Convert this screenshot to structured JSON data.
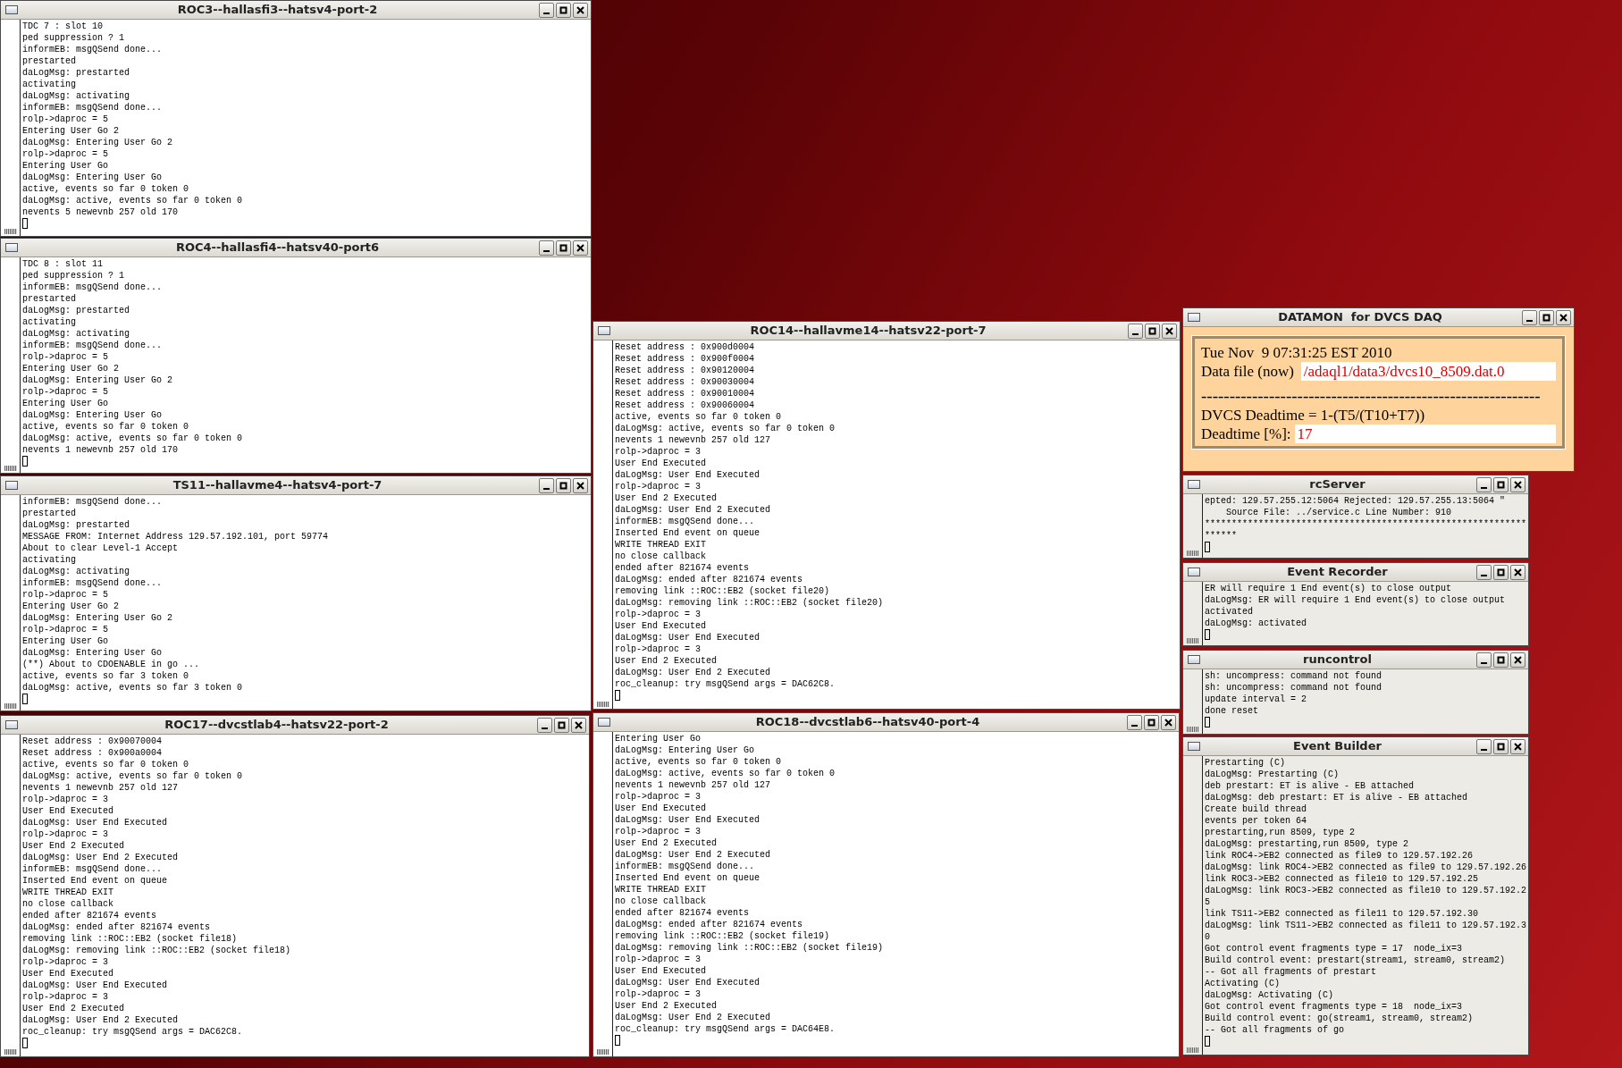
{
  "windows": [
    {
      "kind": "terminal",
      "title": "ROC3--hallasfi3--hatsv4-port-2",
      "lines": [
        "TDC 7 : slot 10",
        "ped suppression ? 1",
        "informEB: msgQSend done...",
        "prestarted",
        "daLogMsg: prestarted",
        "activating",
        "daLogMsg: activating",
        "informEB: msgQSend done...",
        "rolp->daproc = 5",
        "Entering User Go 2",
        "daLogMsg: Entering User Go 2",
        "rolp->daproc = 5",
        "Entering User Go",
        "daLogMsg: Entering User Go",
        "active, events so far 0 token 0",
        "daLogMsg: active, events so far 0 token 0",
        "nevents 5 newevnb 257 old 170"
      ]
    },
    {
      "kind": "terminal",
      "title": "ROC4--hallasfi4--hatsv40-port6",
      "lines": [
        "TDC 8 : slot 11",
        "ped suppression ? 1",
        "informEB: msgQSend done...",
        "prestarted",
        "daLogMsg: prestarted",
        "activating",
        "daLogMsg: activating",
        "informEB: msgQSend done...",
        "rolp->daproc = 5",
        "Entering User Go 2",
        "daLogMsg: Entering User Go 2",
        "rolp->daproc = 5",
        "Entering User Go",
        "daLogMsg: Entering User Go",
        "active, events so far 0 token 0",
        "daLogMsg: active, events so far 0 token 0",
        "nevents 1 newevnb 257 old 170"
      ]
    },
    {
      "kind": "terminal",
      "title": "TS11--hallavme4--hatsv4-port-7",
      "lines": [
        "informEB: msgQSend done...",
        "prestarted",
        "daLogMsg: prestarted",
        "MESSAGE FROM: Internet Address 129.57.192.101, port 59774",
        "About to clear Level-1 Accept",
        "activating",
        "daLogMsg: activating",
        "informEB: msgQSend done...",
        "rolp->daproc = 5",
        "Entering User Go 2",
        "daLogMsg: Entering User Go 2",
        "rolp->daproc = 5",
        "Entering User Go",
        "daLogMsg: Entering User Go",
        "(**) About to CDOENABLE in go ...",
        "active, events so far 3 token 0",
        "daLogMsg: active, events so far 3 token 0"
      ]
    },
    {
      "kind": "terminal",
      "title": "ROC17--dvcstlab4--hatsv22-port-2",
      "lines": [
        "Reset address : 0x90070004",
        "Reset address : 0x900a0004",
        "active, events so far 0 token 0",
        "daLogMsg: active, events so far 0 token 0",
        "nevents 1 newevnb 257 old 127",
        "rolp->daproc = 3",
        "User End Executed",
        "daLogMsg: User End Executed",
        "rolp->daproc = 3",
        "User End 2 Executed",
        "daLogMsg: User End 2 Executed",
        "informEB: msgQSend done...",
        "Inserted End event on queue",
        "WRITE THREAD EXIT",
        "no close callback",
        "ended after 821674 events",
        "daLogMsg: ended after 821674 events",
        "removing link ::ROC::EB2 (socket file18)",
        "daLogMsg: removing link ::ROC::EB2 (socket file18)",
        "rolp->daproc = 3",
        "User End Executed",
        "daLogMsg: User End Executed",
        "rolp->daproc = 3",
        "User End 2 Executed",
        "daLogMsg: User End 2 Executed",
        "roc_cleanup: try msgQSend args = DAC62C8."
      ]
    },
    {
      "kind": "terminal",
      "title": "ROC14--hallavme14--hatsv22-port-7",
      "lines": [
        "Reset address : 0x900d0004",
        "Reset address : 0x900f0004",
        "Reset address : 0x90120004",
        "Reset address : 0x90030004",
        "Reset address : 0x90010004",
        "Reset address : 0x90060004",
        "active, events so far 0 token 0",
        "daLogMsg: active, events so far 0 token 0",
        "nevents 1 newevnb 257 old 127",
        "rolp->daproc = 3",
        "User End Executed",
        "daLogMsg: User End Executed",
        "rolp->daproc = 3",
        "User End 2 Executed",
        "daLogMsg: User End 2 Executed",
        "informEB: msgQSend done...",
        "Inserted End event on queue",
        "WRITE THREAD EXIT",
        "no close callback",
        "ended after 821674 events",
        "daLogMsg: ended after 821674 events",
        "removing link ::ROC::EB2 (socket file20)",
        "daLogMsg: removing link ::ROC::EB2 (socket file20)",
        "rolp->daproc = 3",
        "User End Executed",
        "daLogMsg: User End Executed",
        "rolp->daproc = 3",
        "User End 2 Executed",
        "daLogMsg: User End 2 Executed",
        "roc_cleanup: try msgQSend args = DAC62C8."
      ]
    },
    {
      "kind": "terminal",
      "title": "ROC18--dvcstlab6--hatsv40-port-4",
      "lines": [
        "Entering User Go",
        "daLogMsg: Entering User Go",
        "active, events so far 0 token 0",
        "daLogMsg: active, events so far 0 token 0",
        "nevents 1 newevnb 257 old 127",
        "rolp->daproc = 3",
        "User End Executed",
        "daLogMsg: User End Executed",
        "rolp->daproc = 3",
        "User End 2 Executed",
        "daLogMsg: User End 2 Executed",
        "informEB: msgQSend done...",
        "Inserted End event on queue",
        "WRITE THREAD EXIT",
        "no close callback",
        "ended after 821674 events",
        "daLogMsg: ended after 821674 events",
        "removing link ::ROC::EB2 (socket file19)",
        "daLogMsg: removing link ::ROC::EB2 (socket file19)",
        "rolp->daproc = 3",
        "User End Executed",
        "daLogMsg: User End Executed",
        "rolp->daproc = 3",
        "User End 2 Executed",
        "daLogMsg: User End 2 Executed",
        "roc_cleanup: try msgQSend args = DAC64E8."
      ]
    },
    {
      "kind": "datamon",
      "title": "DATAMON  for DVCS DAQ",
      "date": "Tue Nov  9 07:31:25 EST 2010",
      "file_label": "Data file (now)",
      "file_value": "/adaql1/data3/dvcs10_8509.dat.0",
      "separator": "------------------------------------------------------------",
      "formula": "DVCS Deadtime = 1-(T5/(T10+T7))",
      "deadtime_label": "Deadtime [%]:",
      "deadtime_value": "17"
    },
    {
      "kind": "terminal",
      "title": "rcServer",
      "lines": [
        "epted: 129.57.255.12:5064 Rejected: 129.57.255.13:5064 \"",
        "    Source File: ../service.c Line Number: 910",
        "************************************************************",
        "******"
      ]
    },
    {
      "kind": "terminal",
      "title": "Event Recorder",
      "lines": [
        "ER will require 1 End event(s) to close output",
        "daLogMsg: ER will require 1 End event(s) to close output",
        "activated",
        "daLogMsg: activated"
      ]
    },
    {
      "kind": "terminal",
      "title": "runcontrol",
      "lines": [
        "sh: uncompress: command not found",
        "sh: uncompress: command not found",
        "update interval = 2",
        "done reset"
      ]
    },
    {
      "kind": "terminal",
      "title": "Event Builder",
      "lines": [
        "Prestarting (C)",
        "daLogMsg: Prestarting (C)",
        "deb prestart: ET is alive - EB attached",
        "daLogMsg: deb prestart: ET is alive - EB attached",
        "Create build thread",
        "events per token 64",
        "prestarting,run 8509, type 2",
        "daLogMsg: prestarting,run 8509, type 2",
        "link ROC4->EB2 connected as file9 to 129.57.192.26",
        "daLogMsg: link ROC4->EB2 connected as file9 to 129.57.192.26",
        "link ROC3->EB2 connected as file10 to 129.57.192.25",
        "daLogMsg: link ROC3->EB2 connected as file10 to 129.57.192.2",
        "5",
        "link TS11->EB2 connected as file11 to 129.57.192.30",
        "daLogMsg: link TS11->EB2 connected as file11 to 129.57.192.3",
        "0",
        "Got control event fragments type = 17  node_ix=3",
        "Build control event: prestart(stream1, stream0, stream2)",
        "-- Got all fragments of prestart",
        "Activating (C)",
        "daLogMsg: Activating (C)",
        "Got control event fragments type = 18  node_ix=3",
        "Build control event: go(stream1, stream0, stream2)",
        "-- Got all fragments of go"
      ]
    }
  ]
}
